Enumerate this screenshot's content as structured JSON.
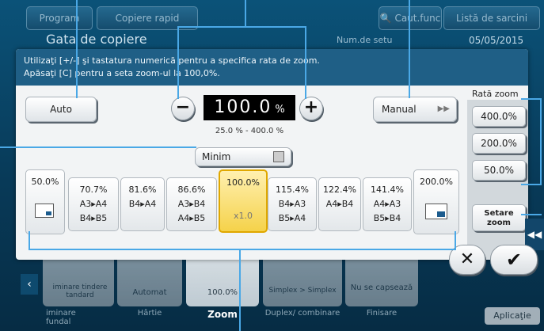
{
  "header": {
    "program_label": "Program",
    "quick_copy_label": "Copiere rapid",
    "search_func_label": "Caut.func",
    "task_list_label": "Listă de sarcini",
    "title": "Gata de copiere",
    "copies_label": "Num.de setu",
    "date": "05/05/2015"
  },
  "dialog": {
    "instruction_line1": "Utilizaţi [+/-] şi tastatura numerică pentru a specifica rata de zoom.",
    "instruction_line2": "Apăsaţi [C] pentru a seta zoom-ul la 100,0%.",
    "auto_label": "Auto",
    "manual_label": "Manual",
    "minus_symbol": "−",
    "plus_symbol": "+",
    "zoom_value": "100.0",
    "zoom_unit": "%",
    "range_text": "25.0 % - 400.0 %",
    "minimal_label": "Minim",
    "presets": [
      {
        "top": "50.0%",
        "mid": "",
        "bot": "",
        "selected": false
      },
      {
        "top": "70.7%",
        "mid": "A3▸A4",
        "bot": "B4▸B5",
        "selected": false
      },
      {
        "top": "81.6%",
        "mid": "B4▸A4",
        "bot": "",
        "selected": false
      },
      {
        "top": "86.6%",
        "mid": "A3▸B4",
        "bot": "A4▸B5",
        "selected": false
      },
      {
        "top": "100.0%",
        "mid": "",
        "bot": "x1.0",
        "selected": true
      },
      {
        "top": "115.4%",
        "mid": "B4▸A3",
        "bot": "B5▸A4",
        "selected": false
      },
      {
        "top": "122.4%",
        "mid": "A4▸B4",
        "bot": "",
        "selected": false
      },
      {
        "top": "141.4%",
        "mid": "A4▸A3",
        "bot": "B5▸B4",
        "selected": false
      },
      {
        "top": "200.0%",
        "mid": "",
        "bot": "",
        "selected": false
      }
    ],
    "zoom_rate_label": "Rată zoom",
    "zoom_rate_buttons": [
      "400.0%",
      "200.0%",
      "50.0%"
    ],
    "set_zoom_line1": "Setare",
    "set_zoom_line2": "zoom",
    "cancel_icon": "close-icon",
    "ok_icon": "check-icon"
  },
  "bottom": {
    "tile_labels": [
      "iminare tindere tandard",
      "Automat",
      "100.0%",
      "Simplex > Simplex",
      "Nu se capsează"
    ],
    "tile_sub_labels": [
      "Hârtie",
      "Zoom",
      "Duplex/ combinare",
      "Finisare"
    ],
    "left_label": "iminare fundal",
    "application_label": "Aplicaţie"
  },
  "colors": {
    "accent": "#4aa8e6",
    "selected_preset": "#f5d24a",
    "instruction_bar": "#1f5f86"
  }
}
